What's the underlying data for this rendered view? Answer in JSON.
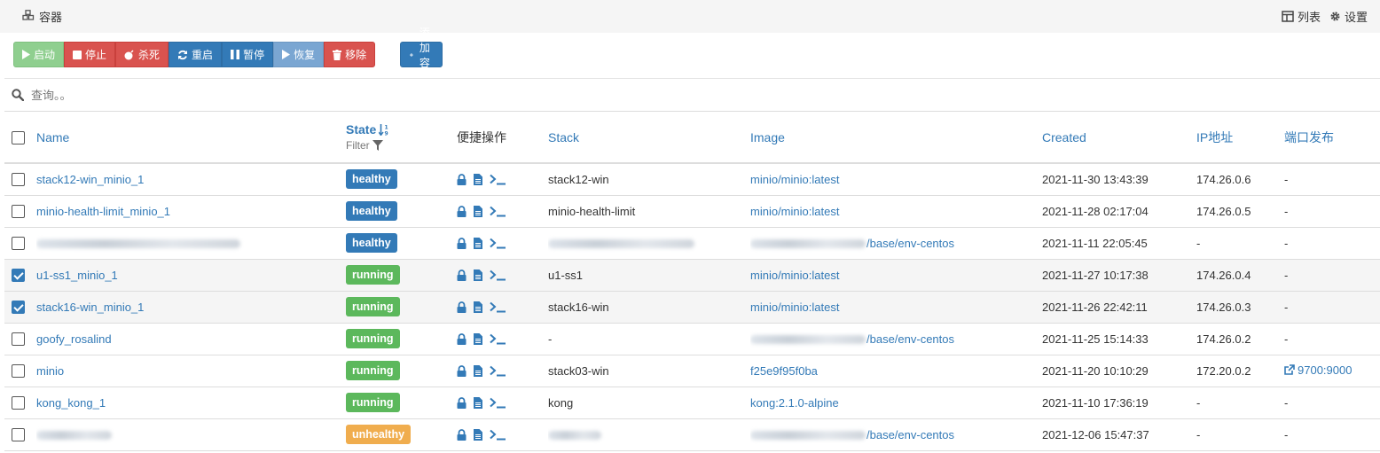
{
  "header": {
    "title": "容器",
    "list_label": "列表",
    "settings_label": "设置"
  },
  "toolbar": {
    "start": "启动",
    "stop": "停止",
    "kill": "杀死",
    "restart": "重启",
    "pause": "暂停",
    "resume": "恢复",
    "remove": "移除",
    "add": "添加容器"
  },
  "search": {
    "placeholder": "查询。。"
  },
  "table": {
    "headers": {
      "name": "Name",
      "state": "State",
      "filter": "Filter",
      "quick": "便捷操作",
      "stack": "Stack",
      "image": "Image",
      "created": "Created",
      "ip": "IP地址",
      "ports": "端口发布"
    },
    "rows": [
      {
        "name": "stack12-win_minio_1",
        "state": "healthy",
        "stack": "stack12-win",
        "image": "minio/minio:latest",
        "created": "2021-11-30 13:43:39",
        "ip": "174.26.0.6",
        "ports": "-",
        "selected": false
      },
      {
        "name": "minio-health-limit_minio_1",
        "state": "healthy",
        "stack": "minio-health-limit",
        "image": "minio/minio:latest",
        "created": "2021-11-28 02:17:04",
        "ip": "174.26.0.5",
        "ports": "-",
        "selected": false
      },
      {
        "name": "",
        "state": "healthy",
        "stack": "",
        "image": "/base/env-centos",
        "created": "2021-11-11 22:05:45",
        "ip": "-",
        "ports": "-",
        "selected": false
      },
      {
        "name": "u1-ss1_minio_1",
        "state": "running",
        "stack": "u1-ss1",
        "image": "minio/minio:latest",
        "created": "2021-11-27 10:17:38",
        "ip": "174.26.0.4",
        "ports": "-",
        "selected": true
      },
      {
        "name": "stack16-win_minio_1",
        "state": "running",
        "stack": "stack16-win",
        "image": "minio/minio:latest",
        "created": "2021-11-26 22:42:11",
        "ip": "174.26.0.3",
        "ports": "-",
        "selected": true
      },
      {
        "name": "goofy_rosalind",
        "state": "running",
        "stack": "-",
        "image": "/base/env-centos",
        "created": "2021-11-25 15:14:33",
        "ip": "174.26.0.2",
        "ports": "-",
        "selected": false
      },
      {
        "name": "minio",
        "state": "running",
        "stack": "stack03-win",
        "image": "f25e9f95f0ba",
        "created": "2021-11-20 10:10:29",
        "ip": "172.20.0.2",
        "ports": "9700:9000",
        "selected": false
      },
      {
        "name": "kong_kong_1",
        "state": "running",
        "stack": "kong",
        "image": "kong:2.1.0-alpine",
        "created": "2021-11-10 17:36:19",
        "ip": "-",
        "ports": "-",
        "selected": false
      },
      {
        "name": "",
        "state": "unhealthy",
        "stack": "",
        "image": "/base/env-centos",
        "created": "2021-12-06 15:47:37",
        "ip": "-",
        "ports": "-",
        "selected": false
      }
    ]
  },
  "colors": {
    "primary": "#337ab7",
    "healthy": "#337ab7",
    "running": "#5cb85c",
    "unhealthy": "#f0ad4e",
    "danger": "#d9534f"
  }
}
